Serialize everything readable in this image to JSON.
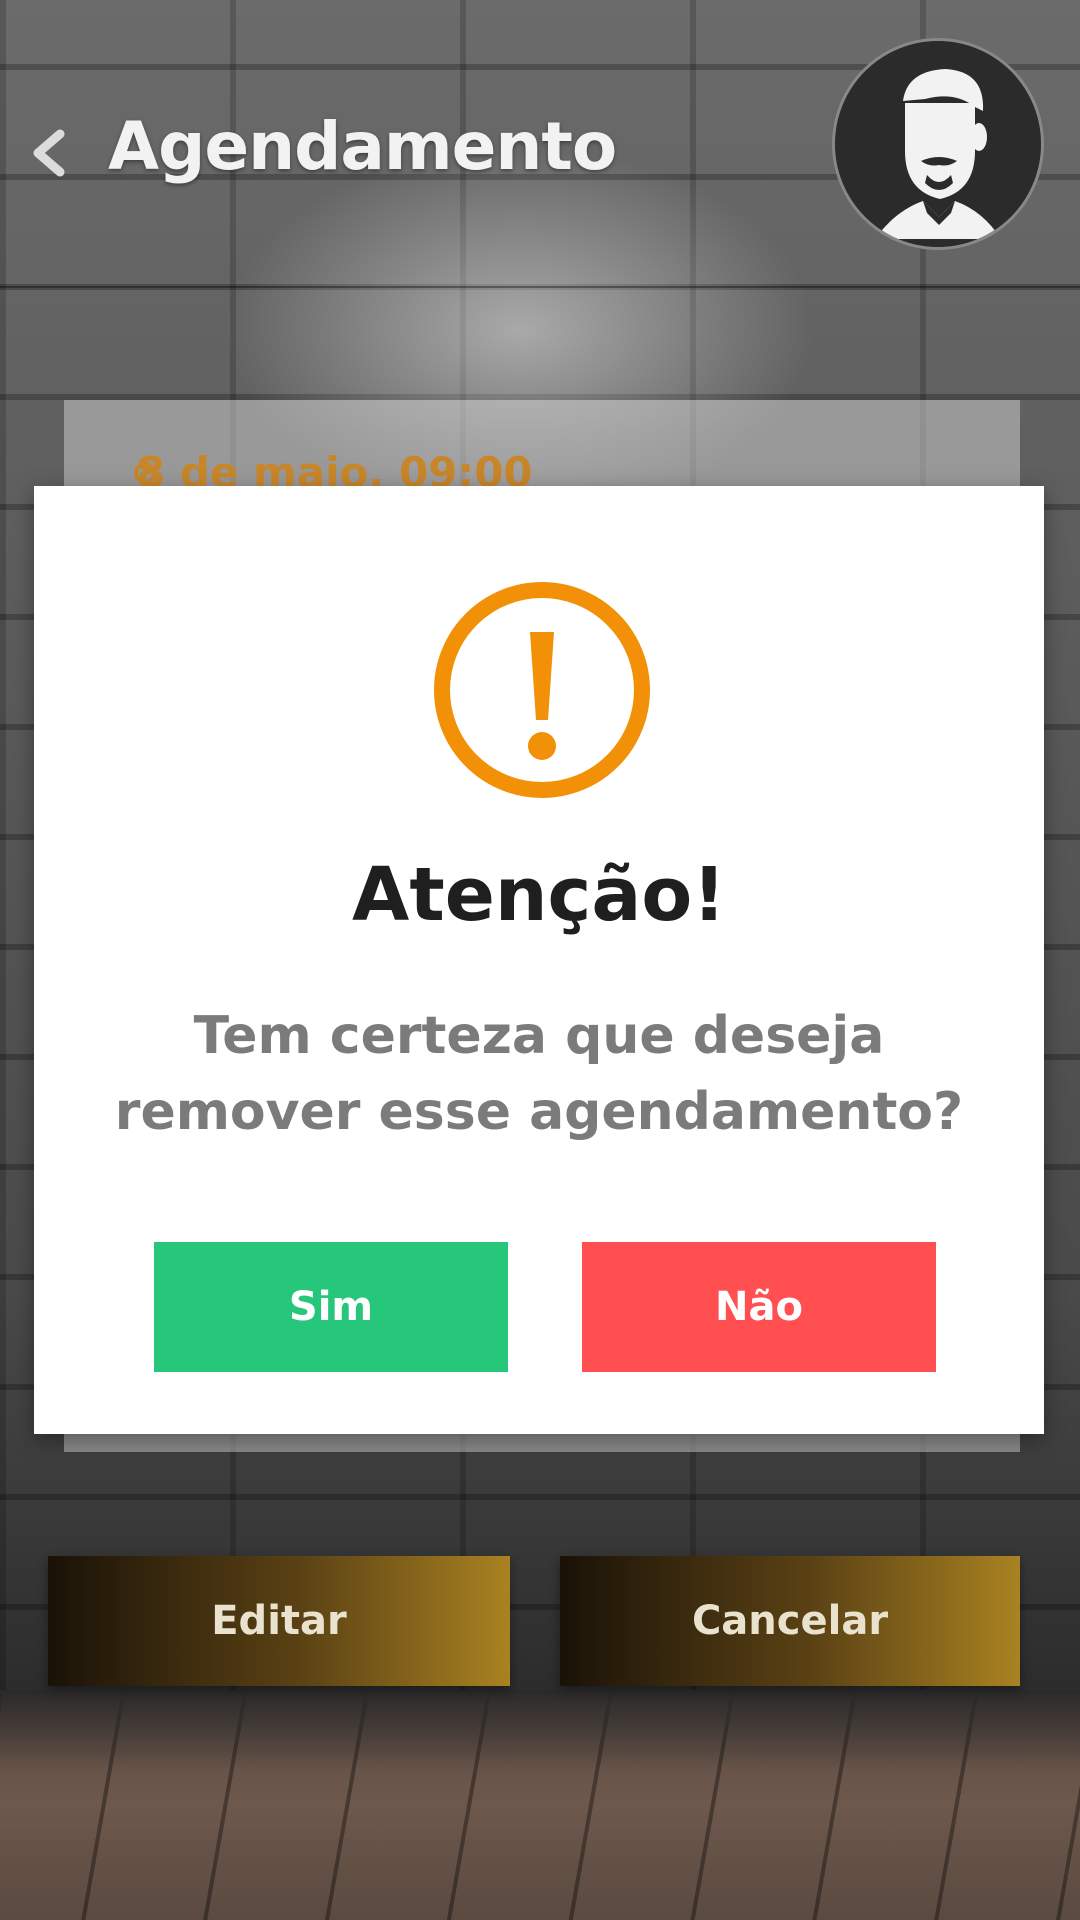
{
  "header": {
    "title": "Agendamento",
    "back_icon": "chevron-left-icon",
    "avatar_icon": "bearded-man-icon"
  },
  "card": {
    "date_text": "8 de maio, 09:00"
  },
  "actions": {
    "edit_label": "Editar",
    "cancel_label": "Cancelar"
  },
  "dialog": {
    "icon": "exclamation-circle-icon",
    "title": "Atenção!",
    "message": "Tem certeza que deseja remover esse agendamento?",
    "confirm_label": "Sim",
    "deny_label": "Não"
  },
  "colors": {
    "accent_orange": "#f29107",
    "confirm_green": "#26c77b",
    "deny_red": "#ff4f51",
    "date_orange": "#c8862a"
  }
}
